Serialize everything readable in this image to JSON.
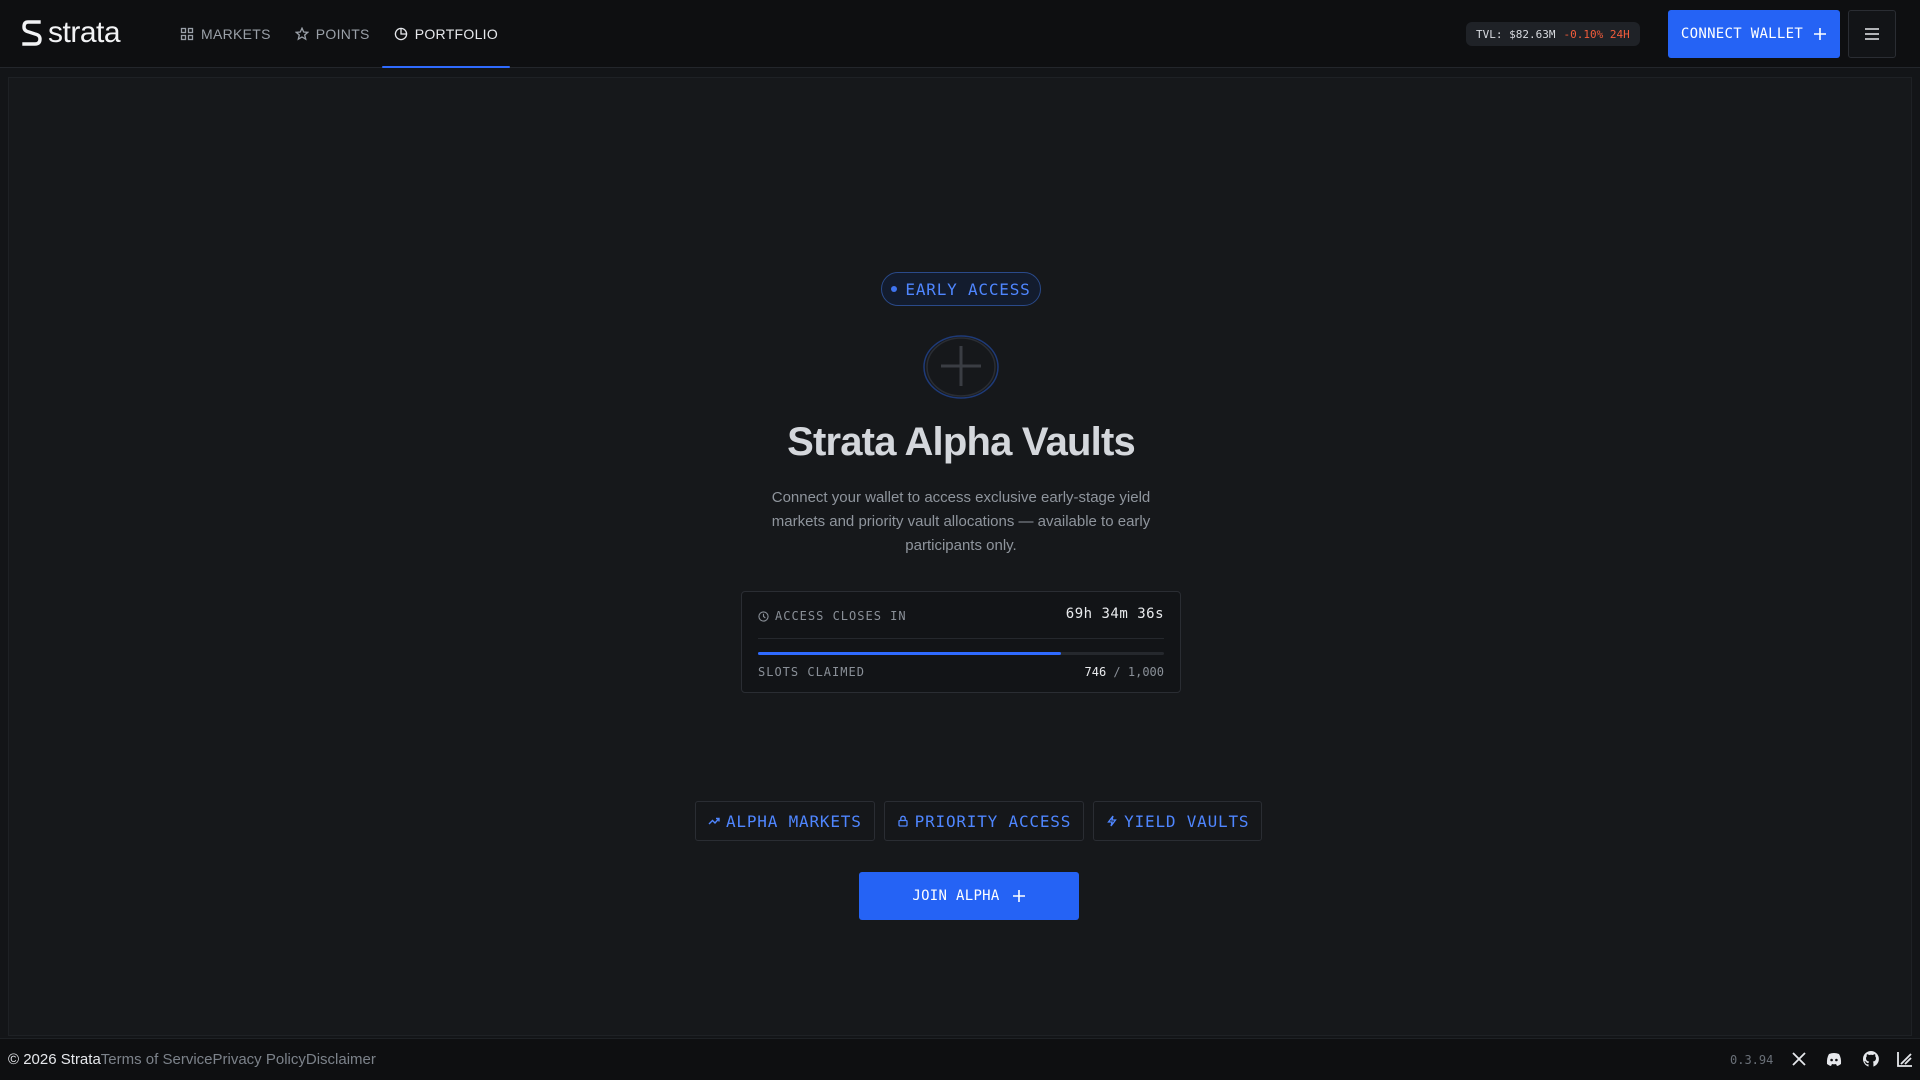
{
  "brand": {
    "name": "strata"
  },
  "nav": {
    "items": [
      {
        "label": "MARKETS",
        "icon": "grid-icon",
        "active": false
      },
      {
        "label": "POINTS",
        "icon": "star-icon",
        "active": false
      },
      {
        "label": "PORTFOLIO",
        "icon": "pie-chart-icon",
        "active": true
      }
    ]
  },
  "tvl": {
    "label": "TVL: $82.63M",
    "change": "-0.10% 24H"
  },
  "header": {
    "connect_label": "CONNECT WALLET"
  },
  "hero": {
    "badge": "EARLY ACCESS",
    "title": "Strata Alpha Vaults",
    "subtitle": "Connect your wallet to access exclusive early-stage yield markets and priority vault allocations — available to early participants only."
  },
  "access": {
    "label": "ACCESS CLOSES IN",
    "timer": "69h 34m 36s",
    "slots_label": "SLOTS CLAIMED",
    "slots_current": "746",
    "slots_sep": " / ",
    "slots_total": "1,000",
    "progress": 0.746
  },
  "features": [
    {
      "label": "ALPHA MARKETS",
      "icon": "trending-up-icon"
    },
    {
      "label": "PRIORITY ACCESS",
      "icon": "lock-icon"
    },
    {
      "label": "YIELD VAULTS",
      "icon": "bolt-icon"
    }
  ],
  "cta": {
    "join_label": "JOIN ALPHA"
  },
  "footer": {
    "copyright_prefix": "© 2026 ",
    "copyright_name": "Strata",
    "links": [
      "Terms of Service",
      "Privacy Policy",
      "Disclaimer"
    ],
    "version": "0.3.94"
  },
  "colors": {
    "accent": "#2563f5",
    "negative": "#f25c3b",
    "badge_text": "#4f86ff"
  }
}
